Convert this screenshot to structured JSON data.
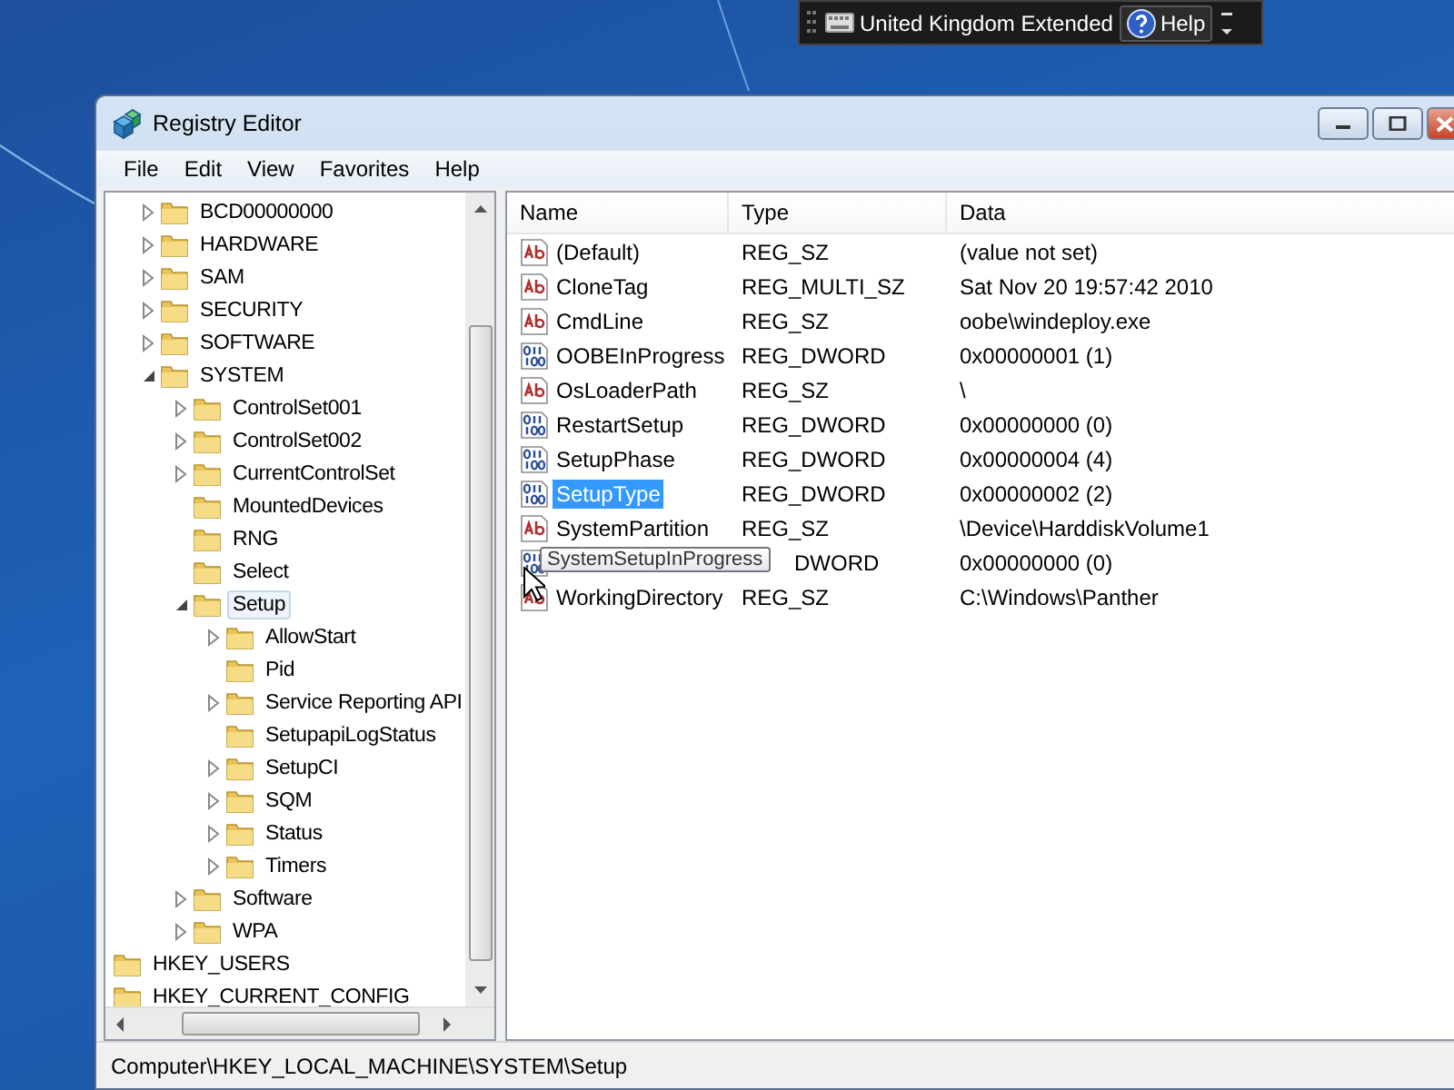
{
  "language_bar": {
    "language": "United Kingdom Extended",
    "help": "Help"
  },
  "window": {
    "title": "Registry Editor"
  },
  "menu": [
    "File",
    "Edit",
    "View",
    "Favorites",
    "Help"
  ],
  "tree": {
    "items": [
      {
        "label": "BCD00000000",
        "expanded": false,
        "selected": false
      },
      {
        "label": "HARDWARE",
        "expanded": false,
        "selected": false
      },
      {
        "label": "SAM",
        "expanded": false,
        "selected": false
      },
      {
        "label": "SECURITY",
        "expanded": false,
        "selected": false
      },
      {
        "label": "SOFTWARE",
        "expanded": false,
        "selected": false
      },
      {
        "label": "SYSTEM",
        "expanded": true,
        "selected": false,
        "children": [
          {
            "label": "ControlSet001",
            "expanded": false,
            "selected": false
          },
          {
            "label": "ControlSet002",
            "expanded": false,
            "selected": false
          },
          {
            "label": "CurrentControlSet",
            "expanded": false,
            "selected": false
          },
          {
            "label": "MountedDevices",
            "selected": false
          },
          {
            "label": "RNG",
            "selected": false
          },
          {
            "label": "Select",
            "selected": false
          },
          {
            "label": "Setup",
            "expanded": true,
            "selected": true,
            "children": [
              {
                "label": "AllowStart",
                "expanded": false,
                "selected": false
              },
              {
                "label": "Pid",
                "selected": false
              },
              {
                "label": "Service Reporting API",
                "expanded": false,
                "selected": false
              },
              {
                "label": "SetupapiLogStatus",
                "selected": false
              },
              {
                "label": "SetupCI",
                "expanded": false,
                "selected": false
              },
              {
                "label": "SQM",
                "expanded": false,
                "selected": false
              },
              {
                "label": "Status",
                "expanded": false,
                "selected": false
              },
              {
                "label": "Timers",
                "expanded": false,
                "selected": false
              }
            ]
          },
          {
            "label": "Software",
            "expanded": false,
            "selected": false
          },
          {
            "label": "WPA",
            "expanded": false,
            "selected": false
          }
        ]
      }
    ],
    "roots": [
      {
        "label": "HKEY_USERS",
        "selected": false
      },
      {
        "label": "HKEY_CURRENT_CONFIG",
        "selected": false
      }
    ]
  },
  "table": {
    "columns": [
      "Name",
      "Type",
      "Data"
    ],
    "rows": [
      {
        "kind": "string",
        "name": "(Default)",
        "type": "REG_SZ",
        "data": "(value not set)",
        "selected": false
      },
      {
        "kind": "string",
        "name": "CloneTag",
        "type": "REG_MULTI_SZ",
        "data": "Sat Nov 20 19:57:42 2010",
        "selected": false
      },
      {
        "kind": "string",
        "name": "CmdLine",
        "type": "REG_SZ",
        "data": "oobe\\windeploy.exe",
        "selected": false
      },
      {
        "kind": "binary",
        "name": "OOBEInProgress",
        "type": "REG_DWORD",
        "data": "0x00000001 (1)",
        "selected": false
      },
      {
        "kind": "string",
        "name": "OsLoaderPath",
        "type": "REG_SZ",
        "data": "\\",
        "selected": false
      },
      {
        "kind": "binary",
        "name": "RestartSetup",
        "type": "REG_DWORD",
        "data": "0x00000000 (0)",
        "selected": false
      },
      {
        "kind": "binary",
        "name": "SetupPhase",
        "type": "REG_DWORD",
        "data": "0x00000004 (4)",
        "selected": false
      },
      {
        "kind": "binary",
        "name": "SetupType",
        "type": "REG_DWORD",
        "data": "0x00000002 (2)",
        "selected": true
      },
      {
        "kind": "string",
        "name": "SystemPartition",
        "type": "REG_SZ",
        "data": "\\Device\\HarddiskVolume1",
        "selected": false
      },
      {
        "kind": "binary",
        "type": "DWORD",
        "data": "0x00000000 (0)",
        "selected": false,
        "tooltip": "SystemSetupInProgress"
      },
      {
        "kind": "string",
        "name": "WorkingDirectory",
        "type": "REG_SZ",
        "data": "C:\\Windows\\Panther",
        "selected": false
      }
    ]
  },
  "status_bar": "Computer\\HKEY_LOCAL_MACHINE\\SYSTEM\\Setup"
}
